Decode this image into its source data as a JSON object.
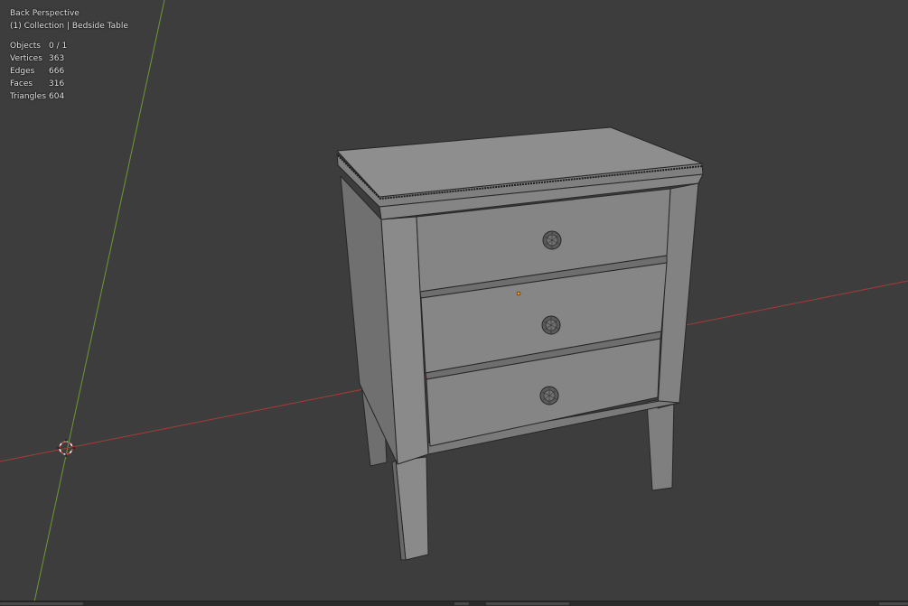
{
  "viewport": {
    "view_name": "Back Perspective",
    "collection_line": "(1) Collection | Bedside Table",
    "background": "#3d3d3d"
  },
  "stats": [
    {
      "label": "Objects",
      "value": "0 / 1"
    },
    {
      "label": "Vertices",
      "value": "363"
    },
    {
      "label": "Edges",
      "value": "666"
    },
    {
      "label": "Faces",
      "value": "316"
    },
    {
      "label": "Triangles",
      "value": "604"
    }
  ],
  "colors": {
    "x_axis": "#a83a3a",
    "y_axis": "#6c9a32",
    "model_light": "#8e8e8e",
    "model_mid": "#7a7a7a",
    "model_dark": "#6b6b6b",
    "wire": "#262626",
    "origin_dot": "#ff9a1a",
    "cursor_red": "#e04848"
  },
  "icons": {
    "cursor": "3d-cursor-icon",
    "origin": "object-origin-icon"
  }
}
